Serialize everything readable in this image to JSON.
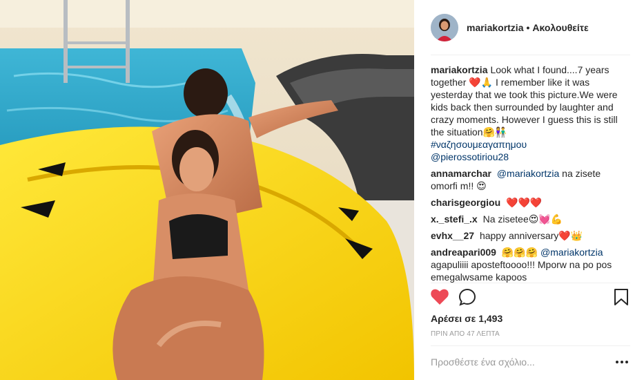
{
  "post": {
    "author": "mariakortzia",
    "separator": "•",
    "follow_status": "Ακολουθείτε",
    "caption": {
      "user": "mariakortzia",
      "text": "Look what I found....7 years together ❤️🙏 I remember like it was yesterday that we took this picture.We were kids back then surrounded by laughter and crazy moments. However I guess this is still the situation🤗👫",
      "hashtag": "#ναζησουμεαγαπημου",
      "mention": "@pierossotiriou28"
    },
    "comments": [
      {
        "user": "annamarchar",
        "mention": "@mariakortzia",
        "text": "na zisete omorfi m!! 😍"
      },
      {
        "user": "charisgeorgiou",
        "mention": "",
        "text": "❤️❤️❤️"
      },
      {
        "user": "x._stefi_.x",
        "mention": "",
        "text": "Na zisetee😍💓💪"
      },
      {
        "user": "evhx__27",
        "mention": "",
        "text": "happy anniversary❤️👑"
      },
      {
        "user": "andreapari009",
        "mention": "🤗🤗🤗 @mariakortzia",
        "text": "agapuliiii aposteftoooo!!! Mporw na po pos emegalwsame kapoos"
      }
    ],
    "likes_label": "Αρέσει σε 1,493",
    "time_label": "ΠΡΙΝ ΑΠΟ 47 ΛΕΠΤΑ",
    "add_comment_placeholder": "Προσθέστε ένα σχόλιο...",
    "icons": {
      "like": "heart-icon",
      "comment": "comment-icon",
      "save": "bookmark-icon",
      "more": "more-options-icon"
    },
    "colors": {
      "heart": "#ed4956",
      "link": "#003569",
      "text": "#262626",
      "muted": "#999999"
    }
  }
}
